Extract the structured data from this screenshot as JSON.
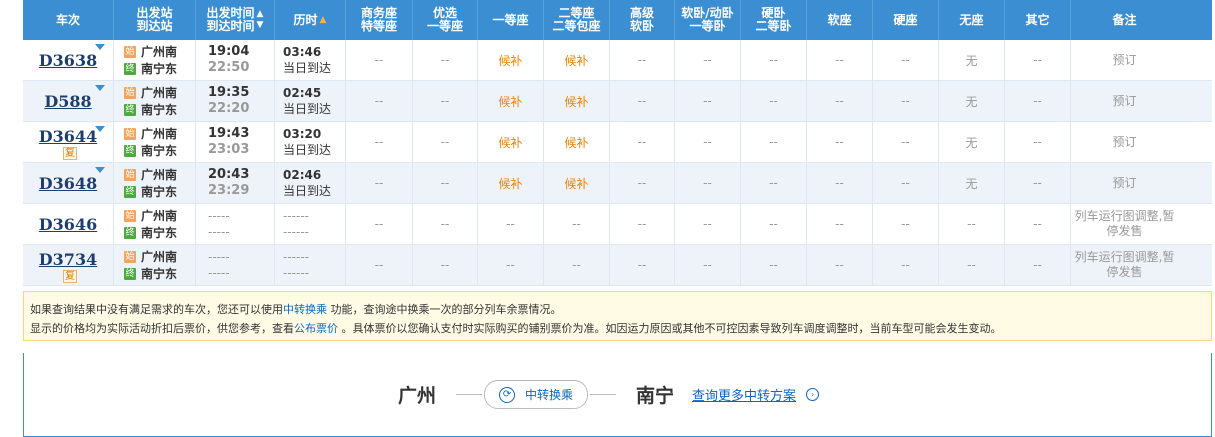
{
  "columns": [
    {
      "label1": "车次",
      "label2": ""
    },
    {
      "label1": "出发站",
      "label2": "到达站"
    },
    {
      "label1": "出发时间",
      "label2": "到达时间"
    },
    {
      "label1": "历时",
      "label2": ""
    },
    {
      "label1": "商务座",
      "label2": "特等座"
    },
    {
      "label1": "优选",
      "label2": "一等座"
    },
    {
      "label1": "一等座",
      "label2": ""
    },
    {
      "label1": "二等座",
      "label2": "二等包座"
    },
    {
      "label1": "高级",
      "label2": "软卧"
    },
    {
      "label1": "软卧/动卧",
      "label2": "一等卧"
    },
    {
      "label1": "硬卧",
      "label2": "二等卧"
    },
    {
      "label1": "软座",
      "label2": ""
    },
    {
      "label1": "硬座",
      "label2": ""
    },
    {
      "label1": "无座",
      "label2": ""
    },
    {
      "label1": "其它",
      "label2": ""
    },
    {
      "label1": "备注",
      "label2": ""
    }
  ],
  "station_icons": {
    "start": "始",
    "end": "终"
  },
  "rows": [
    {
      "train": "D3638",
      "badge": "",
      "from": "广州南",
      "to": "南宁东",
      "dep": "19:04",
      "arr": "22:50",
      "dur": "03:46",
      "dur_note": "当日到达",
      "seats": [
        "--",
        "--",
        "候补",
        "候补",
        "--",
        "--",
        "--",
        "--",
        "--",
        "无",
        "--"
      ],
      "remark": "预订"
    },
    {
      "train": "D588",
      "badge": "",
      "from": "广州南",
      "to": "南宁东",
      "dep": "19:35",
      "arr": "22:20",
      "dur": "02:45",
      "dur_note": "当日到达",
      "seats": [
        "--",
        "--",
        "候补",
        "候补",
        "--",
        "--",
        "--",
        "--",
        "--",
        "无",
        "--"
      ],
      "remark": "预订"
    },
    {
      "train": "D3644",
      "badge": "复",
      "from": "广州南",
      "to": "南宁东",
      "dep": "19:43",
      "arr": "23:03",
      "dur": "03:20",
      "dur_note": "当日到达",
      "seats": [
        "--",
        "--",
        "候补",
        "候补",
        "--",
        "--",
        "--",
        "--",
        "--",
        "无",
        "--"
      ],
      "remark": "预订"
    },
    {
      "train": "D3648",
      "badge": "",
      "from": "广州南",
      "to": "南宁东",
      "dep": "20:43",
      "arr": "23:29",
      "dur": "02:46",
      "dur_note": "当日到达",
      "seats": [
        "--",
        "--",
        "候补",
        "候补",
        "--",
        "--",
        "--",
        "--",
        "--",
        "无",
        "--"
      ],
      "remark": "预订"
    },
    {
      "train": "D3646",
      "badge": "",
      "from": "广州南",
      "to": "南宁东",
      "dep": "-----",
      "arr": "-----",
      "dur": "------",
      "dur_note": "------",
      "seats": [
        "--",
        "--",
        "--",
        "--",
        "--",
        "--",
        "--",
        "--",
        "--",
        "--",
        "--"
      ],
      "remark": "列车运行图调整,暂停发售"
    },
    {
      "train": "D3734",
      "badge": "复",
      "from": "广州南",
      "to": "南宁东",
      "dep": "-----",
      "arr": "-----",
      "dur": "------",
      "dur_note": "------",
      "seats": [
        "--",
        "--",
        "--",
        "--",
        "--",
        "--",
        "--",
        "--",
        "--",
        "--",
        "--"
      ],
      "remark": "列车运行图调整,暂停发售"
    }
  ],
  "notice": {
    "line1_a": "如果查询结果中没有满足需求的车次，您还可以使用",
    "line1_link": "中转换乘",
    "line1_b": " 功能，查询途中换乘一次的部分列车余票情况。",
    "line2_a": "显示的价格均为实际活动折扣后票价，供您参考，查看",
    "line2_link": "公布票价",
    "line2_b": " 。具体票价以您确认支付时实际购买的铺别票价为准。如因运力原因或其他不可控因素导致列车调度调整时，当前车型可能会发生变动。"
  },
  "transfer": {
    "from": "广州",
    "button": "中转换乘",
    "to": "南宁",
    "more": "查询更多中转方案"
  }
}
